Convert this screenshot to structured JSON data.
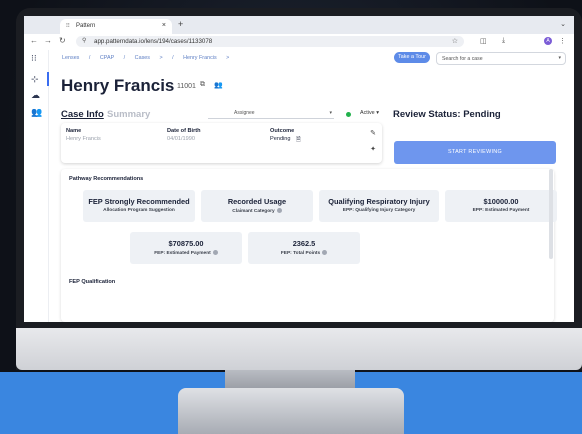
{
  "browser": {
    "tab_title": "Pattern",
    "tab_close": "×",
    "new_tab": "+",
    "url": "app.patterndata.io/lens/194/cases/1133078",
    "profile_initial": "A"
  },
  "breadcrumbs": [
    "Lenses",
    "/",
    "CPAP",
    "/",
    "Cases",
    ">",
    "/",
    "Henry Francis",
    ">"
  ],
  "header": {
    "take_tour": "Take a Tour",
    "search_placeholder": "Search for a case",
    "patient_name": "Henry Francis",
    "patient_id": "11001"
  },
  "tabs": {
    "case_info": "Case Info",
    "summary": "Summary"
  },
  "controls": {
    "assignee_label": "Assignee",
    "status_value": "Active",
    "status_color": "#22b14c"
  },
  "info_card": {
    "name_label": "Name",
    "name_value": "Henry Francis",
    "dob_label": "Date of Birth",
    "dob_value": "04/01/1990",
    "outcome_label": "Outcome",
    "outcome_value": "Pending"
  },
  "review": {
    "title": "Review Status: Pending",
    "button": "START REVIEWING"
  },
  "pathway": {
    "title": "Pathway Recommendations",
    "cards": [
      {
        "value": "FEP Strongly Recommended",
        "label": "Allocation Program Suggestion",
        "info": false
      },
      {
        "value": "Recorded Usage",
        "label": "Claimant Category",
        "info": true
      },
      {
        "value": "Qualifying Respiratory Injury",
        "label": "EPP: Qualifying Injury Category",
        "info": false
      },
      {
        "value": "$10000.00",
        "label": "EPP: Estimated Payment",
        "info": false
      },
      {
        "value": "$70875.00",
        "label": "FEP: Estimated Payment",
        "info": true
      },
      {
        "value": "2362.5",
        "label": "FEP: Total Points",
        "info": true
      }
    ],
    "section2": "FEP Qualification"
  },
  "colors": {
    "accent": "#5d8be8",
    "primary_button": "#6e96ee",
    "heading": "#1b2238"
  }
}
